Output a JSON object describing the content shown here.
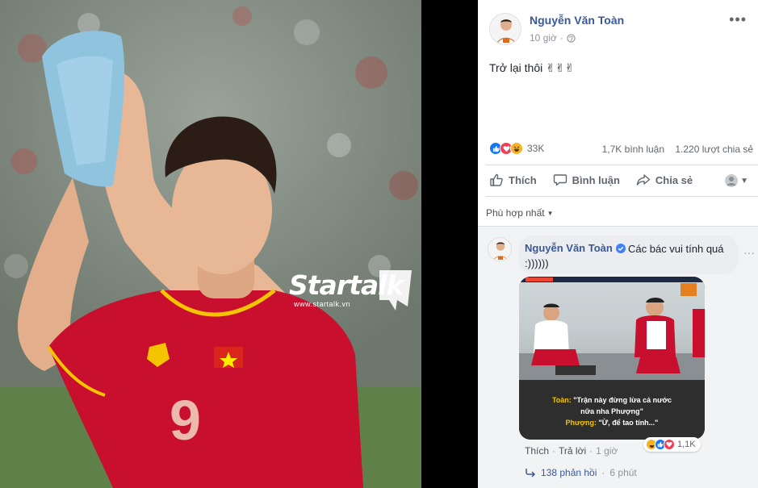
{
  "photo": {
    "watermark_brand": "Startalk",
    "watermark_url": "www.startalk.vn",
    "jersey_number": "9"
  },
  "post": {
    "author": "Nguyễn Văn Toàn",
    "time": "10 giờ",
    "text": "Trở lại thôi ✌✌✌",
    "reaction_count": "33K",
    "comments_count": "1,7K bình luận",
    "shares_count": "1.220 lượt chia sẻ",
    "reaction_icons": [
      "like-icon",
      "love-icon",
      "haha-icon"
    ]
  },
  "actions": {
    "like": "Thích",
    "comment": "Bình luận",
    "share": "Chia sẻ"
  },
  "comments_sort": "Phù hợp nhất",
  "comment": {
    "author": "Nguyễn Văn Toàn",
    "text_line1": "Các bác vui tính quá",
    "text_line2": ":))))))",
    "image_caption_line1_name": "Toàn:",
    "image_caption_line1": " \"Trận này đừng lừa cả nước",
    "image_caption_line2": "nữa nha Phượng\"",
    "image_caption_line3_name": "Phượng:",
    "image_caption_line3": " \"Ừ, để tao tính...\"",
    "like_label": "Thích",
    "reply_label": "Trả lời",
    "time": "1 giờ",
    "reaction_count": "1,1K",
    "replies_label": "138 phản hồi",
    "replies_time": "6 phút"
  },
  "colors": {
    "link_blue": "#385898",
    "like_blue": "#1877f2",
    "love_red": "#f33e58",
    "haha_yellow": "#f7b125",
    "jersey_red": "#c8102e"
  }
}
